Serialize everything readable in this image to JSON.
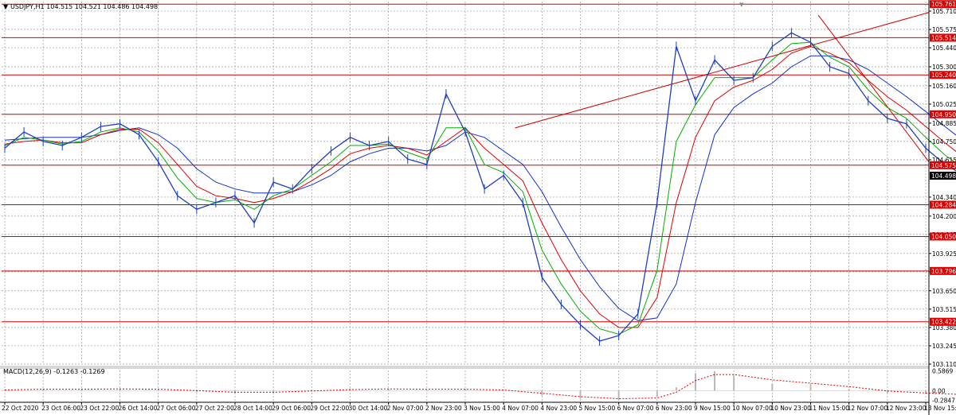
{
  "header": {
    "symbol_info": "USDJPY,H1  104.515 104.521 104.486 104.498",
    "macd_info": "MACD(12,26,9) -0.1263 -0.1269"
  },
  "colors": {
    "price": "#1f3fbf",
    "level": "#d40000",
    "ma_fast": "#00b000",
    "ma_mid": "#e00000",
    "ma_slow": "#1030d0",
    "grid": "#9a9a9a",
    "tag_bg": "#e00000",
    "current_tag_bg": "#000000",
    "macd_signal": "#e00000",
    "macd_hist": "#b8b8b8"
  },
  "chart_data": {
    "type": "line",
    "title": "USDJPY,H1",
    "ylim": [
      103.11,
      105.78
    ],
    "y_ticks": [
      "105.710",
      "105.575",
      "105.440",
      "105.300",
      "105.160",
      "105.025",
      "104.885",
      "104.750",
      "104.615",
      "104.340",
      "104.200",
      "104.065",
      "103.925",
      "103.790",
      "103.650",
      "103.515",
      "103.380",
      "103.245",
      "103.110"
    ],
    "x_ticks": [
      "22 Oct 2020",
      "23 Oct 06:00",
      "23 Oct 22:00",
      "26 Oct 14:00",
      "27 Oct 06:00",
      "27 Oct 22:00",
      "28 Oct 14:00",
      "29 Oct 06:00",
      "29 Oct 22:00",
      "30 Oct 14:00",
      "2 Nov 07:00",
      "2 Nov 23:00",
      "3 Nov 15:00",
      "4 Nov 07:00",
      "4 Nov 23:00",
      "5 Nov 15:00",
      "6 Nov 07:00",
      "6 Nov 23:00",
      "9 Nov 15:00",
      "10 Nov 07:00",
      "10 Nov 23:00",
      "11 Nov 15:00",
      "12 Nov 07:00",
      "12 Nov 23:00",
      "13 Nov 15:00"
    ],
    "levels": [
      105.761,
      105.514,
      105.24,
      104.95,
      104.575,
      104.284,
      104.05,
      103.796,
      103.422
    ],
    "level_labels": [
      "105.761",
      "105.514",
      "105.240",
      "104.950",
      "104.575",
      "104.284",
      "104.050",
      "103.796",
      "103.422"
    ],
    "current_price": 104.498,
    "current_price_label": "104.498",
    "trendlines": [
      {
        "from": [
          13.3,
          104.85
        ],
        "to": [
          25.5,
          105.7
        ]
      },
      {
        "from": [
          21.2,
          105.68
        ],
        "to": [
          25.5,
          104.6
        ]
      }
    ],
    "series": [
      {
        "role": "price",
        "x": [
          0,
          0.5,
          1,
          1.5,
          2,
          2.5,
          3,
          3.5,
          4,
          4.5,
          5,
          5.5,
          6,
          6.5,
          7,
          7.5,
          8,
          8.5,
          9,
          9.5,
          10,
          10.5,
          11,
          11.5,
          12,
          12.5,
          13,
          13.5,
          14,
          14.5,
          15,
          15.5,
          16,
          16.5,
          17,
          17.5,
          18,
          18.5,
          19,
          19.5,
          20,
          20.5,
          21,
          21.5,
          22,
          22.5,
          23,
          23.5,
          24,
          24.5,
          25
        ],
        "values": [
          104.7,
          104.82,
          104.75,
          104.72,
          104.78,
          104.86,
          104.88,
          104.8,
          104.6,
          104.35,
          104.25,
          104.3,
          104.35,
          104.15,
          104.45,
          104.4,
          104.55,
          104.68,
          104.78,
          104.72,
          104.75,
          104.62,
          104.58,
          105.1,
          104.82,
          104.4,
          104.5,
          104.3,
          103.75,
          103.55,
          103.4,
          103.28,
          103.32,
          103.48,
          104.3,
          105.45,
          105.05,
          105.35,
          105.2,
          105.22,
          105.45,
          105.55,
          105.48,
          105.3,
          105.25,
          105.05,
          104.92,
          104.88,
          104.7,
          104.58,
          104.5
        ]
      },
      {
        "role": "ma_fast",
        "x": [
          0,
          0.5,
          1,
          1.5,
          2,
          2.5,
          3,
          3.5,
          4,
          4.5,
          5,
          5.5,
          6,
          6.5,
          7,
          7.5,
          8,
          8.5,
          9,
          9.5,
          10,
          10.5,
          11,
          11.5,
          12,
          12.5,
          13,
          13.5,
          14,
          14.5,
          15,
          15.5,
          16,
          16.5,
          17,
          17.5,
          18,
          18.5,
          19,
          19.5,
          20,
          20.5,
          21,
          21.5,
          22,
          22.5,
          23,
          23.5,
          24,
          24.5,
          25
        ],
        "values": [
          104.72,
          104.78,
          104.76,
          104.73,
          104.75,
          104.82,
          104.85,
          104.82,
          104.68,
          104.48,
          104.33,
          104.3,
          104.32,
          104.25,
          104.35,
          104.4,
          104.5,
          104.6,
          104.72,
          104.72,
          104.73,
          104.67,
          104.62,
          104.85,
          104.85,
          104.58,
          104.52,
          104.38,
          103.95,
          103.7,
          103.5,
          103.37,
          103.33,
          103.4,
          103.8,
          104.75,
          105.02,
          105.22,
          105.22,
          105.22,
          105.35,
          105.47,
          105.48,
          105.37,
          105.3,
          105.13,
          105.0,
          104.92,
          104.78,
          104.65,
          104.55
        ]
      },
      {
        "role": "ma_mid",
        "x": [
          0,
          0.5,
          1,
          1.5,
          2,
          2.5,
          3,
          3.5,
          4,
          4.5,
          5,
          5.5,
          6,
          6.5,
          7,
          7.5,
          8,
          8.5,
          9,
          9.5,
          10,
          10.5,
          11,
          11.5,
          12,
          12.5,
          13,
          13.5,
          14,
          14.5,
          15,
          15.5,
          16,
          16.5,
          17,
          17.5,
          18,
          18.5,
          19,
          19.5,
          20,
          20.5,
          21,
          21.5,
          22,
          22.5,
          23,
          23.5,
          24,
          24.5,
          25
        ],
        "values": [
          104.73,
          104.75,
          104.76,
          104.74,
          104.74,
          104.8,
          104.84,
          104.84,
          104.74,
          104.58,
          104.42,
          104.35,
          104.33,
          104.3,
          104.33,
          104.38,
          104.46,
          104.55,
          104.66,
          104.7,
          104.72,
          104.7,
          104.65,
          104.75,
          104.85,
          104.7,
          104.58,
          104.46,
          104.15,
          103.88,
          103.65,
          103.48,
          103.38,
          103.38,
          103.6,
          104.3,
          104.78,
          105.05,
          105.15,
          105.2,
          105.28,
          105.4,
          105.45,
          105.4,
          105.33,
          105.2,
          105.08,
          104.98,
          104.86,
          104.74,
          104.63
        ]
      },
      {
        "role": "ma_slow",
        "x": [
          0,
          0.5,
          1,
          1.5,
          2,
          2.5,
          3,
          3.5,
          4,
          4.5,
          5,
          5.5,
          6,
          6.5,
          7,
          7.5,
          8,
          8.5,
          9,
          9.5,
          10,
          10.5,
          11,
          11.5,
          12,
          12.5,
          13,
          13.5,
          14,
          14.5,
          15,
          15.5,
          16,
          16.5,
          17,
          17.5,
          18,
          18.5,
          19,
          19.5,
          20,
          20.5,
          21,
          21.5,
          22,
          22.5,
          23,
          23.5,
          24,
          24.5,
          25
        ],
        "values": [
          104.76,
          104.77,
          104.78,
          104.78,
          104.78,
          104.8,
          104.83,
          104.85,
          104.8,
          104.7,
          104.55,
          104.45,
          104.4,
          104.37,
          104.37,
          104.38,
          104.43,
          104.5,
          104.6,
          104.66,
          104.7,
          104.7,
          104.68,
          104.72,
          104.82,
          104.78,
          104.68,
          104.58,
          104.38,
          104.12,
          103.88,
          103.68,
          103.52,
          103.43,
          103.45,
          103.7,
          104.3,
          104.8,
          105.0,
          105.1,
          105.18,
          105.3,
          105.38,
          105.38,
          105.35,
          105.28,
          105.18,
          105.08,
          104.97,
          104.86,
          104.75
        ]
      }
    ],
    "macd": {
      "ylim": [
        -0.3,
        0.6
      ],
      "y_ticks": [
        "0.5869",
        "0.00",
        "-0.2847"
      ],
      "x": [
        0,
        1,
        2,
        3,
        4,
        5,
        6,
        7,
        8,
        9,
        10,
        11,
        12,
        13,
        14,
        15,
        16,
        17,
        17.5,
        18,
        18.5,
        19,
        20,
        21,
        22,
        23,
        24,
        25
      ],
      "main": [
        0.02,
        0.05,
        0.03,
        0.06,
        0.02,
        -0.05,
        -0.08,
        -0.04,
        0.03,
        0.06,
        0.05,
        0.02,
        0.05,
        0.0,
        -0.15,
        -0.24,
        -0.28,
        -0.18,
        0.1,
        0.52,
        0.58,
        0.45,
        0.2,
        0.18,
        0.05,
        -0.08,
        -0.1,
        -0.13
      ],
      "signal": [
        0.02,
        0.04,
        0.04,
        0.05,
        0.04,
        0.0,
        -0.05,
        -0.05,
        -0.01,
        0.03,
        0.05,
        0.04,
        0.04,
        0.02,
        -0.08,
        -0.18,
        -0.24,
        -0.22,
        -0.05,
        0.3,
        0.48,
        0.48,
        0.32,
        0.22,
        0.12,
        -0.01,
        -0.07,
        -0.12
      ]
    }
  }
}
